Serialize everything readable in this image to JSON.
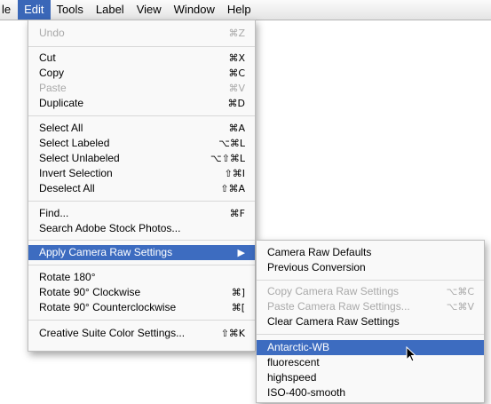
{
  "menubar": {
    "items": [
      "le",
      "Edit",
      "Tools",
      "Label",
      "View",
      "Window",
      "Help"
    ]
  },
  "edit_menu": {
    "items": [
      {
        "label": "Undo",
        "shortcut": "⌘Z"
      },
      {
        "label": "Cut",
        "shortcut": "⌘X"
      },
      {
        "label": "Copy",
        "shortcut": "⌘C"
      },
      {
        "label": "Paste",
        "shortcut": "⌘V"
      },
      {
        "label": "Duplicate",
        "shortcut": "⌘D"
      },
      {
        "label": "Select All",
        "shortcut": "⌘A"
      },
      {
        "label": "Select Labeled",
        "shortcut": "⌥⌘L"
      },
      {
        "label": "Select Unlabeled",
        "shortcut": "⌥⇧⌘L"
      },
      {
        "label": "Invert Selection",
        "shortcut": "⇧⌘I"
      },
      {
        "label": "Deselect All",
        "shortcut": "⇧⌘A"
      },
      {
        "label": "Find...",
        "shortcut": "⌘F"
      },
      {
        "label": "Search Adobe Stock Photos...",
        "shortcut": ""
      },
      {
        "label": "Apply Camera Raw Settings",
        "shortcut": "▶"
      },
      {
        "label": "Rotate 180°",
        "shortcut": ""
      },
      {
        "label": "Rotate 90° Clockwise",
        "shortcut": "⌘]"
      },
      {
        "label": "Rotate 90° Counterclockwise",
        "shortcut": "⌘["
      },
      {
        "label": "Creative Suite Color Settings...",
        "shortcut": "⇧⌘K"
      }
    ]
  },
  "camera_raw_submenu": {
    "items": [
      {
        "label": "Camera Raw Defaults",
        "shortcut": ""
      },
      {
        "label": "Previous Conversion",
        "shortcut": ""
      },
      {
        "label": "Copy Camera Raw Settings",
        "shortcut": "⌥⌘C"
      },
      {
        "label": "Paste Camera Raw Settings...",
        "shortcut": "⌥⌘V"
      },
      {
        "label": "Clear Camera Raw Settings",
        "shortcut": ""
      },
      {
        "label": "Antarctic-WB",
        "shortcut": ""
      },
      {
        "label": "fluorescent",
        "shortcut": ""
      },
      {
        "label": "highspeed",
        "shortcut": ""
      },
      {
        "label": "ISO-400-smooth",
        "shortcut": ""
      }
    ]
  },
  "colors": {
    "highlight": "#3d6cc0",
    "disabled_text": "#a9a9a9"
  }
}
